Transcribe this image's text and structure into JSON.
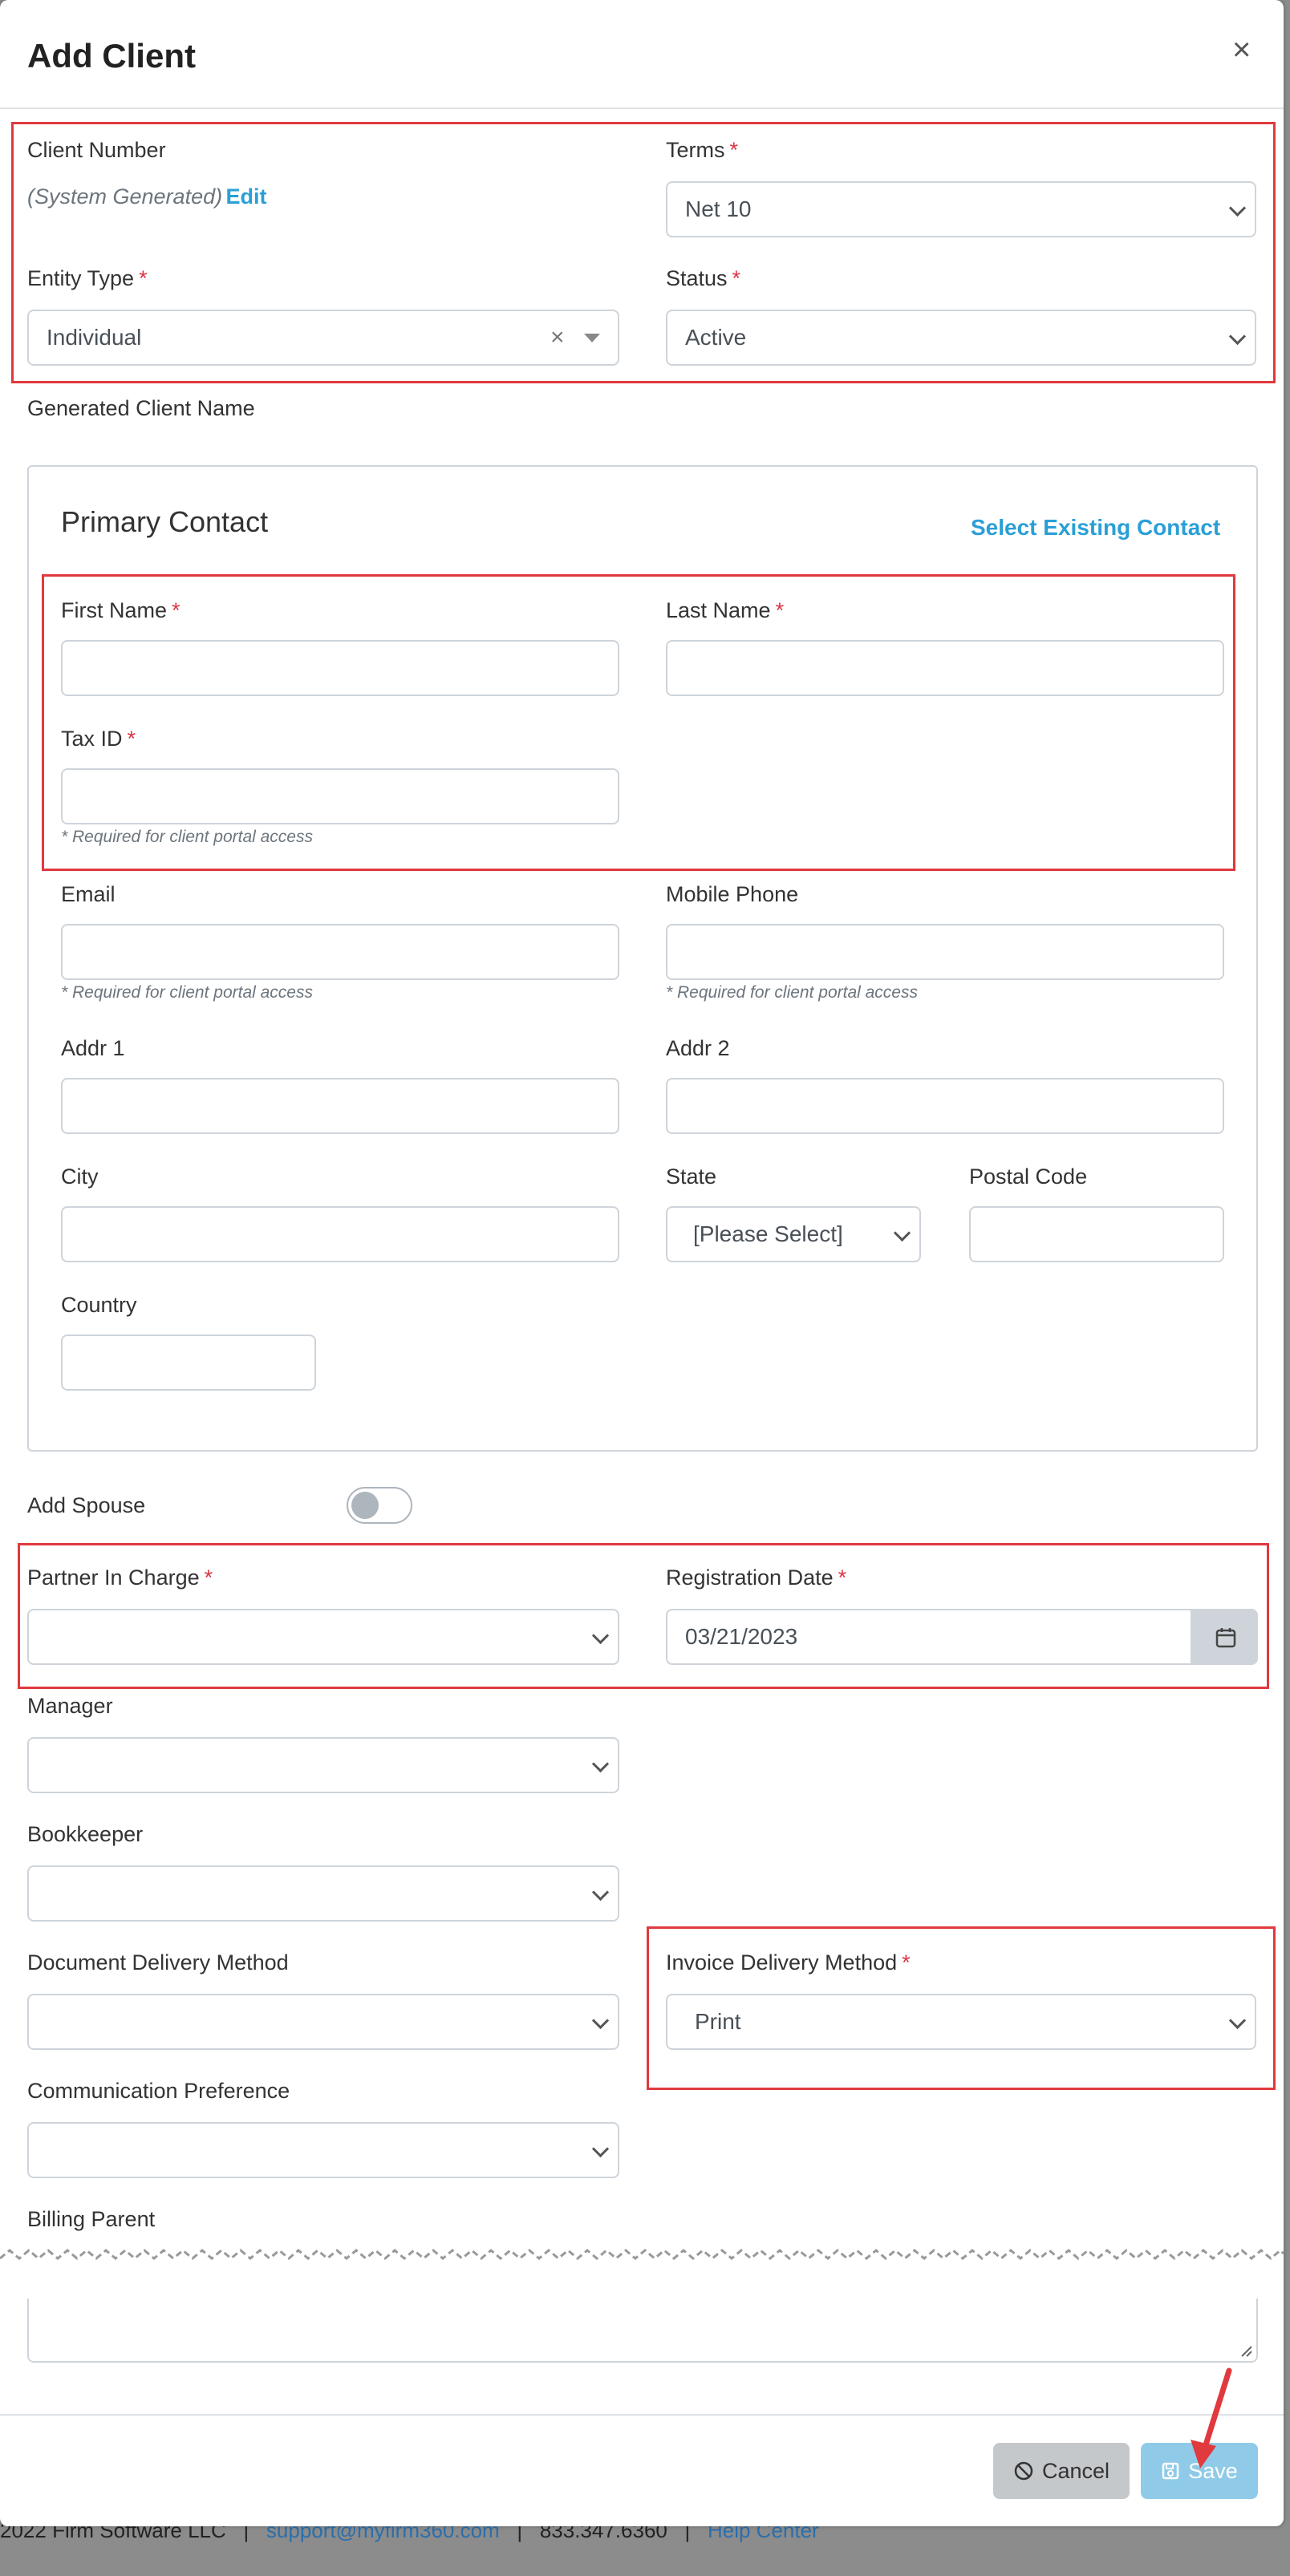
{
  "modal": {
    "title": "Add Client",
    "close": "×"
  },
  "client_number": {
    "label": "Client Number",
    "value": "(System Generated)",
    "edit": "Edit"
  },
  "terms": {
    "label": "Terms",
    "value": "Net 10"
  },
  "entity_type": {
    "label": "Entity Type",
    "value": "Individual",
    "clear": "×"
  },
  "status": {
    "label": "Status",
    "value": "Active"
  },
  "generated_name": {
    "label": "Generated Client Name"
  },
  "primary_contact": {
    "title": "Primary Contact",
    "select_existing": "Select Existing Contact",
    "first_name": "First Name",
    "last_name": "Last Name",
    "tax_id": "Tax ID",
    "tax_hint": "* Required for client portal access",
    "email": "Email",
    "email_hint": "* Required for client portal access",
    "mobile": "Mobile Phone",
    "mobile_hint": "* Required for client portal access",
    "addr1": "Addr 1",
    "addr2": "Addr 2",
    "city": "City",
    "state": "State",
    "state_value": "[Please Select]",
    "postal": "Postal Code",
    "country": "Country"
  },
  "spouse": {
    "label": "Add Spouse"
  },
  "partner": {
    "label": "Partner In Charge"
  },
  "registration": {
    "label": "Registration Date",
    "value": "03/21/2023"
  },
  "manager": {
    "label": "Manager"
  },
  "bookkeeper": {
    "label": "Bookkeeper"
  },
  "doc_delivery": {
    "label": "Document Delivery Method"
  },
  "invoice_delivery": {
    "label": "Invoice Delivery Method",
    "value": "Print"
  },
  "comm_pref": {
    "label": "Communication Preference"
  },
  "billing_parent": {
    "label": "Billing Parent"
  },
  "buttons": {
    "cancel": "Cancel",
    "save": "Save"
  },
  "footer": {
    "copyright": "2022 Firm Software LLC",
    "sep": "|",
    "email": "support@myfirm360.com",
    "phone": "833.347.6360",
    "help": "Help Center"
  },
  "required_mark": "*",
  "colors": {
    "accent": "#2a9fd6",
    "required": "#dc3545",
    "highlight": "#e0393e",
    "save_button": "#8fcbe8",
    "cancel_button": "#c4c8cb"
  }
}
